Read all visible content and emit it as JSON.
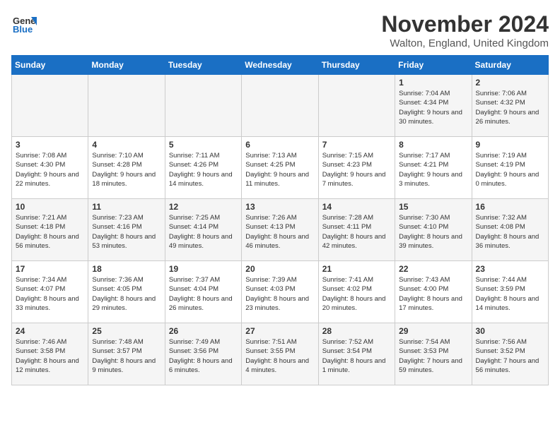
{
  "logo": {
    "text_general": "General",
    "text_blue": "Blue"
  },
  "title": "November 2024",
  "subtitle": "Walton, England, United Kingdom",
  "headers": [
    "Sunday",
    "Monday",
    "Tuesday",
    "Wednesday",
    "Thursday",
    "Friday",
    "Saturday"
  ],
  "weeks": [
    [
      {
        "day": "",
        "info": ""
      },
      {
        "day": "",
        "info": ""
      },
      {
        "day": "",
        "info": ""
      },
      {
        "day": "",
        "info": ""
      },
      {
        "day": "",
        "info": ""
      },
      {
        "day": "1",
        "info": "Sunrise: 7:04 AM\nSunset: 4:34 PM\nDaylight: 9 hours\nand 30 minutes."
      },
      {
        "day": "2",
        "info": "Sunrise: 7:06 AM\nSunset: 4:32 PM\nDaylight: 9 hours\nand 26 minutes."
      }
    ],
    [
      {
        "day": "3",
        "info": "Sunrise: 7:08 AM\nSunset: 4:30 PM\nDaylight: 9 hours\nand 22 minutes."
      },
      {
        "day": "4",
        "info": "Sunrise: 7:10 AM\nSunset: 4:28 PM\nDaylight: 9 hours\nand 18 minutes."
      },
      {
        "day": "5",
        "info": "Sunrise: 7:11 AM\nSunset: 4:26 PM\nDaylight: 9 hours\nand 14 minutes."
      },
      {
        "day": "6",
        "info": "Sunrise: 7:13 AM\nSunset: 4:25 PM\nDaylight: 9 hours\nand 11 minutes."
      },
      {
        "day": "7",
        "info": "Sunrise: 7:15 AM\nSunset: 4:23 PM\nDaylight: 9 hours\nand 7 minutes."
      },
      {
        "day": "8",
        "info": "Sunrise: 7:17 AM\nSunset: 4:21 PM\nDaylight: 9 hours\nand 3 minutes."
      },
      {
        "day": "9",
        "info": "Sunrise: 7:19 AM\nSunset: 4:19 PM\nDaylight: 9 hours\nand 0 minutes."
      }
    ],
    [
      {
        "day": "10",
        "info": "Sunrise: 7:21 AM\nSunset: 4:18 PM\nDaylight: 8 hours\nand 56 minutes."
      },
      {
        "day": "11",
        "info": "Sunrise: 7:23 AM\nSunset: 4:16 PM\nDaylight: 8 hours\nand 53 minutes."
      },
      {
        "day": "12",
        "info": "Sunrise: 7:25 AM\nSunset: 4:14 PM\nDaylight: 8 hours\nand 49 minutes."
      },
      {
        "day": "13",
        "info": "Sunrise: 7:26 AM\nSunset: 4:13 PM\nDaylight: 8 hours\nand 46 minutes."
      },
      {
        "day": "14",
        "info": "Sunrise: 7:28 AM\nSunset: 4:11 PM\nDaylight: 8 hours\nand 42 minutes."
      },
      {
        "day": "15",
        "info": "Sunrise: 7:30 AM\nSunset: 4:10 PM\nDaylight: 8 hours\nand 39 minutes."
      },
      {
        "day": "16",
        "info": "Sunrise: 7:32 AM\nSunset: 4:08 PM\nDaylight: 8 hours\nand 36 minutes."
      }
    ],
    [
      {
        "day": "17",
        "info": "Sunrise: 7:34 AM\nSunset: 4:07 PM\nDaylight: 8 hours\nand 33 minutes."
      },
      {
        "day": "18",
        "info": "Sunrise: 7:36 AM\nSunset: 4:05 PM\nDaylight: 8 hours\nand 29 minutes."
      },
      {
        "day": "19",
        "info": "Sunrise: 7:37 AM\nSunset: 4:04 PM\nDaylight: 8 hours\nand 26 minutes."
      },
      {
        "day": "20",
        "info": "Sunrise: 7:39 AM\nSunset: 4:03 PM\nDaylight: 8 hours\nand 23 minutes."
      },
      {
        "day": "21",
        "info": "Sunrise: 7:41 AM\nSunset: 4:02 PM\nDaylight: 8 hours\nand 20 minutes."
      },
      {
        "day": "22",
        "info": "Sunrise: 7:43 AM\nSunset: 4:00 PM\nDaylight: 8 hours\nand 17 minutes."
      },
      {
        "day": "23",
        "info": "Sunrise: 7:44 AM\nSunset: 3:59 PM\nDaylight: 8 hours\nand 14 minutes."
      }
    ],
    [
      {
        "day": "24",
        "info": "Sunrise: 7:46 AM\nSunset: 3:58 PM\nDaylight: 8 hours\nand 12 minutes."
      },
      {
        "day": "25",
        "info": "Sunrise: 7:48 AM\nSunset: 3:57 PM\nDaylight: 8 hours\nand 9 minutes."
      },
      {
        "day": "26",
        "info": "Sunrise: 7:49 AM\nSunset: 3:56 PM\nDaylight: 8 hours\nand 6 minutes."
      },
      {
        "day": "27",
        "info": "Sunrise: 7:51 AM\nSunset: 3:55 PM\nDaylight: 8 hours\nand 4 minutes."
      },
      {
        "day": "28",
        "info": "Sunrise: 7:52 AM\nSunset: 3:54 PM\nDaylight: 8 hours\nand 1 minute."
      },
      {
        "day": "29",
        "info": "Sunrise: 7:54 AM\nSunset: 3:53 PM\nDaylight: 7 hours\nand 59 minutes."
      },
      {
        "day": "30",
        "info": "Sunrise: 7:56 AM\nSunset: 3:52 PM\nDaylight: 7 hours\nand 56 minutes."
      }
    ]
  ]
}
